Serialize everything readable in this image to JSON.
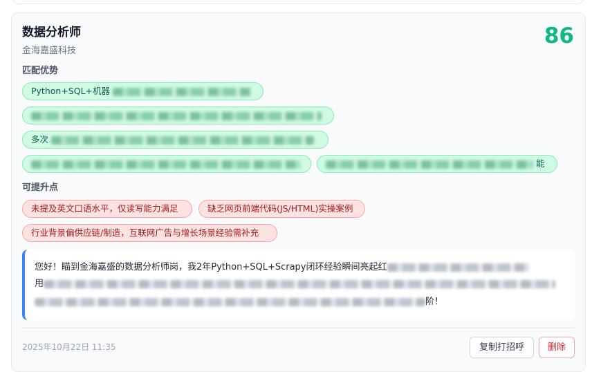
{
  "job": {
    "title": "数据分析师",
    "company": "金海嘉盛科技",
    "score": "86"
  },
  "advantages": {
    "label": "匹配优势",
    "items": [
      {
        "text": "Python+SQL+机器"
      },
      {
        "text": ""
      },
      {
        "text": "多次"
      },
      {
        "text": ""
      },
      {
        "text": "能"
      }
    ]
  },
  "improvements": {
    "label": "可提升点",
    "items": [
      "未提及英文口语水平，仅读写能力满足",
      "缺乏网页前端代码(JS/HTML)实操案例",
      "行业背景偏供应链/制造，互联网广告与增长场景经验需补充"
    ]
  },
  "greeting": {
    "line1": "您好！瞄到金海嘉盛的数据分析师岗，我2年Python+SQL+Scrapy闭环经验瞬间亮起红",
    "line2": "用",
    "line3_end": "阶！"
  },
  "footer": {
    "timestamp": "2025年10月22日 11:35",
    "copy_label": "复制打招呼",
    "delete_label": "删除"
  },
  "colors": {
    "score": "#10b981",
    "advantage_chip": "#d1fae5",
    "improvement_chip": "#fee2e2",
    "greeting_accent": "#3b82f6",
    "delete": "#dc2626"
  }
}
